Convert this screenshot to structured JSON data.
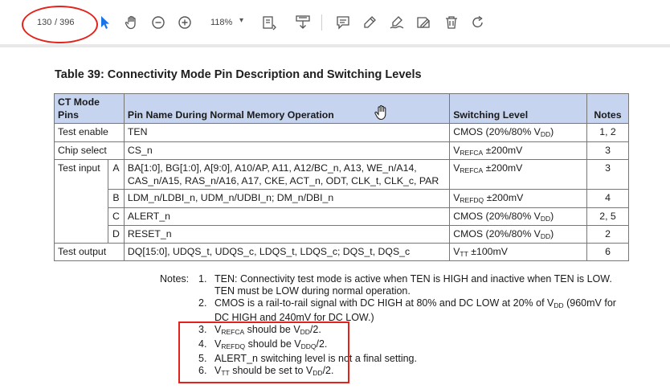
{
  "toolbar": {
    "current_page": "130",
    "total_pages": "/ 396",
    "zoom": "118%",
    "zoom_caret": "▾",
    "icons": [
      "select-arrow-icon",
      "hand-icon",
      "zoom-out-icon",
      "zoom-in-icon",
      "fit-page-icon",
      "download-icon",
      "comment-icon",
      "highlight-icon",
      "sign-icon",
      "edit-icon",
      "delete-icon",
      "redo-icon"
    ],
    "accent_color": "#1a73e8",
    "annotation_color": "#e3231b"
  },
  "document": {
    "title": "Table 39: Connectivity Mode Pin Description and Switching Levels",
    "table": {
      "header_bg": "#c6d4ef",
      "headers": {
        "ct_mode": "CT Mode Pins",
        "pin_name": "Pin Name During Normal Memory Operation",
        "switching": "Switching Level",
        "notes": "Notes"
      },
      "rows": {
        "test_enable": {
          "mode": "Test enable",
          "pins": "TEN",
          "level_pre": "CMOS (20%/80% V",
          "level_sub": "DD",
          "level_post": ")",
          "notes": "1, 2"
        },
        "chip_select": {
          "mode": "Chip select",
          "pins": "CS_n",
          "level_pre": "V",
          "level_sub": "REFCA",
          "level_post": " ±200mV",
          "notes": "3"
        },
        "test_input": {
          "mode": "Test input",
          "a": {
            "sub": "A",
            "pins": "BA[1:0], BG[1:0], A[9:0], A10/AP, A11, A12/BC_n, A13, WE_n/A14, CAS_n/A15, RAS_n/A16, A17, CKE, ACT_n, ODT, CLK_t, CLK_c, PAR",
            "level_pre": "V",
            "level_sub": "REFCA",
            "level_post": " ±200mV",
            "notes": "3"
          },
          "b": {
            "sub": "B",
            "pins": "LDM_n/LDBI_n, UDM_n/UDBI_n; DM_n/DBI_n",
            "level_pre": "V",
            "level_sub": "REFDQ",
            "level_post": " ±200mV",
            "notes": "4"
          },
          "c": {
            "sub": "C",
            "pins": "ALERT_n",
            "level_pre": "CMOS (20%/80% V",
            "level_sub": "DD",
            "level_post": ")",
            "notes": "2, 5"
          },
          "d": {
            "sub": "D",
            "pins": "RESET_n",
            "level_pre": "CMOS (20%/80% V",
            "level_sub": "DD",
            "level_post": ")",
            "notes": "2"
          }
        },
        "test_output": {
          "mode": "Test output",
          "pins": "DQ[15:0], UDQS_t, UDQS_c, LDQS_t, LDQS_c; DQS_t, DQS_c",
          "level_pre": "V",
          "level_sub": "TT",
          "level_post": " ±100mV",
          "notes": "6"
        }
      }
    },
    "notes_label": "Notes:",
    "notes": {
      "n1": {
        "num": "1.",
        "text": "TEN: Connectivity test mode is active when TEN is HIGH and inactive when TEN is LOW. TEN must be LOW during normal operation."
      },
      "n2": {
        "num": "2.",
        "pre": "CMOS is a rail-to-rail signal with DC HIGH at 80% and DC LOW at 20% of V",
        "sub": "DD",
        "post": " (960mV for DC HIGH and 240mV for DC LOW.)"
      },
      "n3": {
        "num": "3.",
        "a": "V",
        "a_sub": "REFCA",
        "b": " should be V",
        "b_sub": "DD",
        "c": "/2."
      },
      "n4": {
        "num": "4.",
        "a": "V",
        "a_sub": "REFDQ",
        "b": " should be V",
        "b_sub": "DDQ",
        "c": "/2."
      },
      "n5": {
        "num": "5.",
        "text": "ALERT_n switching level is not a final setting."
      },
      "n6": {
        "num": "6.",
        "a": "V",
        "a_sub": "TT",
        "b": " should be set to V",
        "b_sub": "DD",
        "c": "/2."
      }
    }
  }
}
